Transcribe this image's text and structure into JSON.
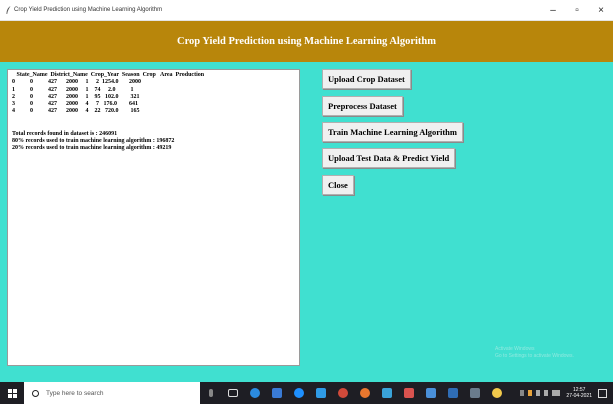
{
  "window": {
    "title": "Crop Yield Prediction using Machine Learning Algorithm",
    "minimize": "–",
    "maximize": "▫",
    "close": "×"
  },
  "banner": {
    "title": "Crop Yield Prediction using Machine Learning Algorithm"
  },
  "output": {
    "header": "   State_Name  District_Name  Crop_Year  Season  Crop   Area  Production",
    "rows": [
      "0          0          427      2000     1     2  1254.0       2000",
      "1          0          427      2000     1    74     2.0          1",
      "2          0          427      2000     1    95   102.0        321",
      "3          0          427      2000     4     7   176.0        641",
      "4          0          427      2000     4    22   720.0        165"
    ],
    "total_records": "Total records found in dataset is : 246091",
    "train_records": "80% records used to train machine learning algorithm : 196872",
    "test_records": "20% records used to train machine learning algorithm : 49219"
  },
  "buttons": {
    "upload": "Upload Crop Dataset",
    "preprocess": "Preprocess Dataset",
    "train": "Train Machine Learning Algorithm",
    "predict": "Upload Test Data & Predict Yield",
    "close": "Close"
  },
  "watermark": {
    "line1": "Activate Windows",
    "line2": "Go to Settings to activate Windows."
  },
  "taskbar": {
    "search_placeholder": "Type here to search",
    "time": "12:57",
    "date": "27-04-2021"
  },
  "colors": {
    "background": "#40e0d0",
    "banner": "#b8860b",
    "taskbar": "#1e1e24"
  }
}
